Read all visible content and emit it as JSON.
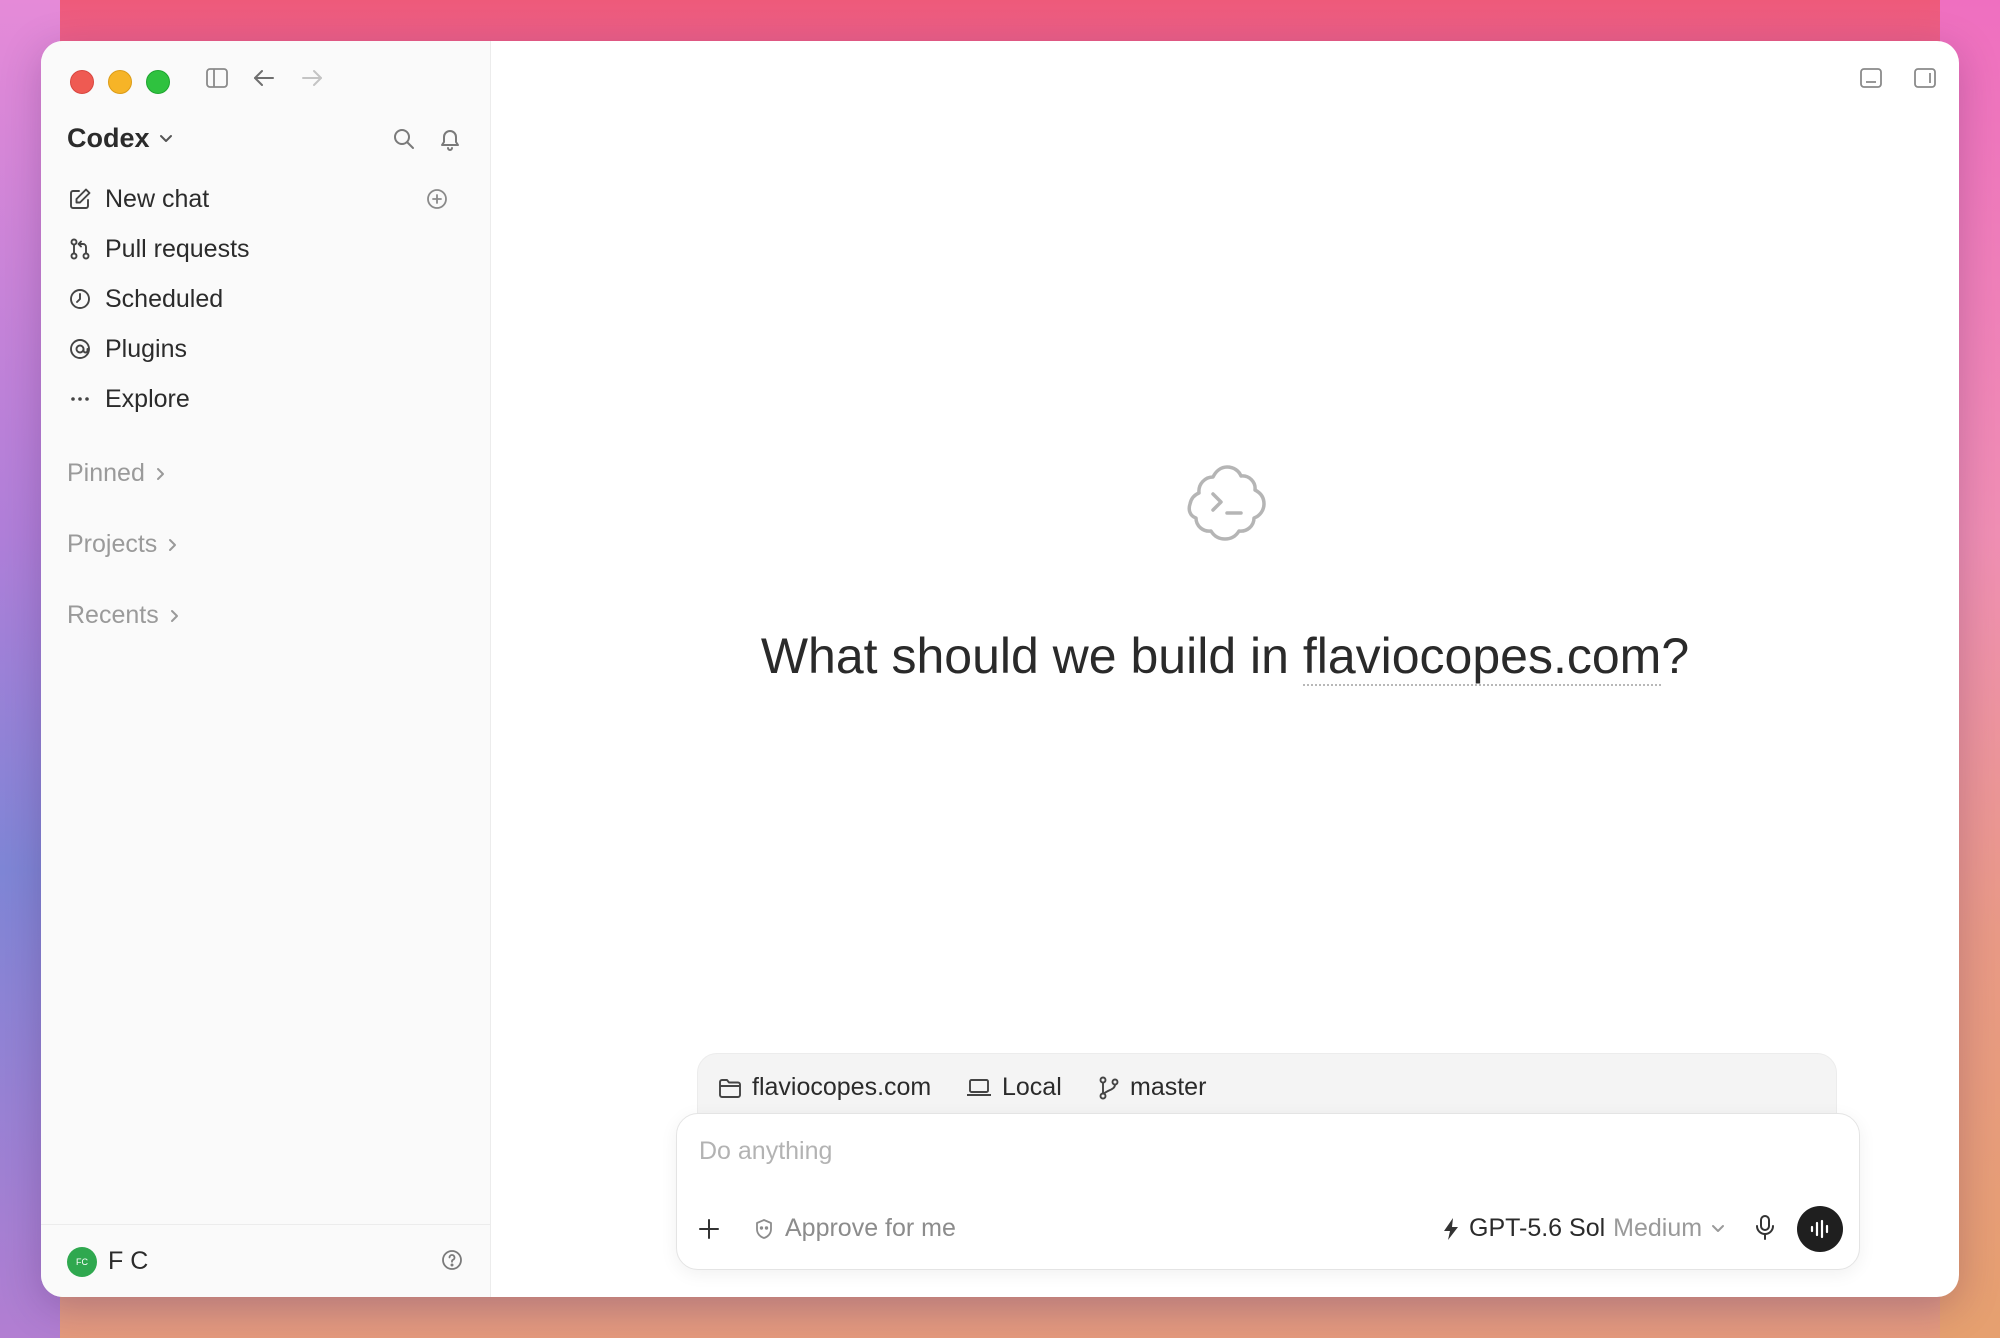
{
  "window": {
    "app_name": "Codex"
  },
  "sidebar": {
    "items": [
      {
        "label": "New chat",
        "icon": "edit-icon"
      },
      {
        "label": "Pull requests",
        "icon": "git-pull-request-icon"
      },
      {
        "label": "Scheduled",
        "icon": "clock-icon"
      },
      {
        "label": "Plugins",
        "icon": "plugin-at-icon"
      },
      {
        "label": "Explore",
        "icon": "ellipsis-icon"
      }
    ],
    "sections": [
      {
        "label": "Pinned"
      },
      {
        "label": "Projects"
      },
      {
        "label": "Recents"
      }
    ],
    "user": {
      "initials": "FC",
      "name": "F C"
    }
  },
  "main": {
    "hero_prefix": "What should we build in ",
    "hero_project": "flaviocopes.com",
    "hero_suffix": "?"
  },
  "context": {
    "folder": "flaviocopes.com",
    "environment": "Local",
    "branch": "master"
  },
  "composer": {
    "placeholder": "Do anything",
    "approval": "Approve for me",
    "model_name": "GPT-5.6 Sol",
    "model_effort": "Medium"
  },
  "colors": {
    "accent_dark": "#1f1f1f",
    "avatar_green": "#2fa84f"
  }
}
